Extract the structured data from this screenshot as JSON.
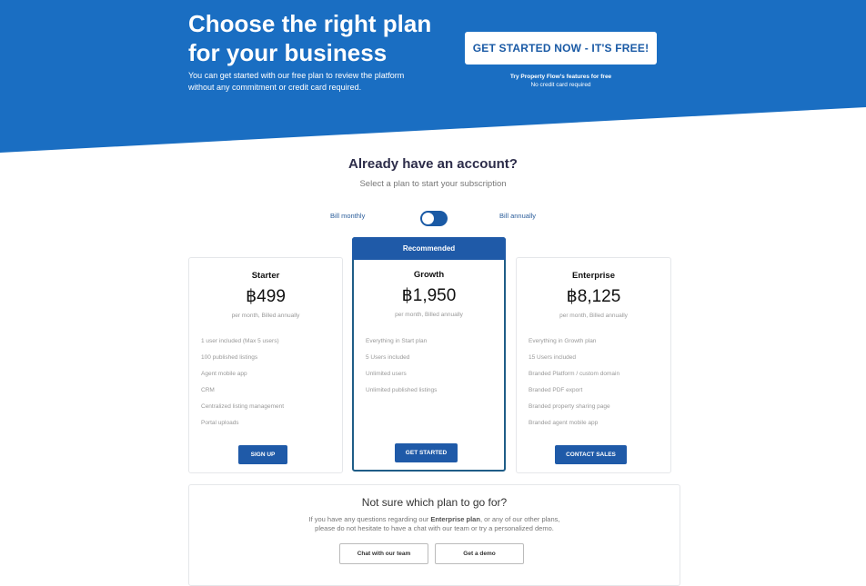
{
  "hero": {
    "title_line1": "Choose the right plan",
    "title_line2": "for your business",
    "subtitle": "You can get started with our free plan to review the platform without any commitment or credit card required.",
    "cta_label": "GET STARTED NOW - IT'S FREE!",
    "note_line1": "Try Property Flow's features for free",
    "note_line2": "No credit card required"
  },
  "account": {
    "title": "Already have an account?",
    "subtitle": "Select a plan to start your subscription"
  },
  "billing": {
    "monthly_label": "Bill monthly",
    "annually_label": "Bill annually",
    "annual_selected": false
  },
  "plans": [
    {
      "name": "Starter",
      "price": "฿499",
      "period": "per month, Billed annually",
      "features": [
        "1 user included (Max 5 users)",
        "100 published listings",
        "Agent mobile app",
        "CRM",
        "Centralized listing management",
        "Portal uploads"
      ],
      "button": "SIGN UP"
    },
    {
      "badge": "Recommended",
      "name": "Growth",
      "price": "฿1,950",
      "period": "per month, Billed annually",
      "features": [
        "Everything in Start plan",
        "5 Users included",
        "Unlimited users",
        "Unlimited published listings"
      ],
      "button": "GET STARTED"
    },
    {
      "name": "Enterprise",
      "price": "฿8,125",
      "period": "per month, Billed annually",
      "features": [
        "Everything in Growth plan",
        "15 Users included",
        "Branded Platform / custom domain",
        "Branded PDF export",
        "Branded property sharing page",
        "Branded agent mobile app"
      ],
      "button": "CONTACT SALES"
    }
  ],
  "help": {
    "title": "Not sure which plan to go for?",
    "text_before": "If you have any questions regarding our ",
    "text_bold": "Enterprise plan",
    "text_after": ", or any of our other plans,",
    "text_line2": "please do not hesitate to have a chat with our team or try a personalized demo.",
    "chat_button": "Chat with our team",
    "demo_button": "Get a demo"
  },
  "colors": {
    "brand_blue": "#1a6ec2",
    "button_blue": "#1f5aa8",
    "recommended_border": "#1f5d87"
  }
}
